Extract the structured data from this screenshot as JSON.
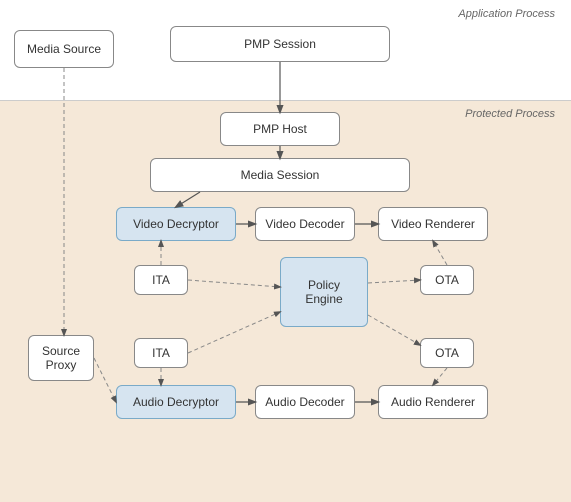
{
  "labels": {
    "app_process": "Application Process",
    "protected_process": "Protected Process"
  },
  "boxes": {
    "media_source": "Media Source",
    "pmp_session": "PMP Session",
    "pmp_host": "PMP Host",
    "media_session": "Media Session",
    "video_decryptor": "Video Decryptor",
    "video_decoder": "Video Decoder",
    "video_renderer": "Video Renderer",
    "ita_top": "ITA",
    "ota_top": "OTA",
    "policy_engine": "Policy\nEngine",
    "ita_bottom": "ITA",
    "ota_bottom": "OTA",
    "audio_decryptor": "Audio Decryptor",
    "audio_decoder": "Audio Decoder",
    "audio_renderer": "Audio Renderer",
    "source_proxy": "Source\nProxy"
  }
}
